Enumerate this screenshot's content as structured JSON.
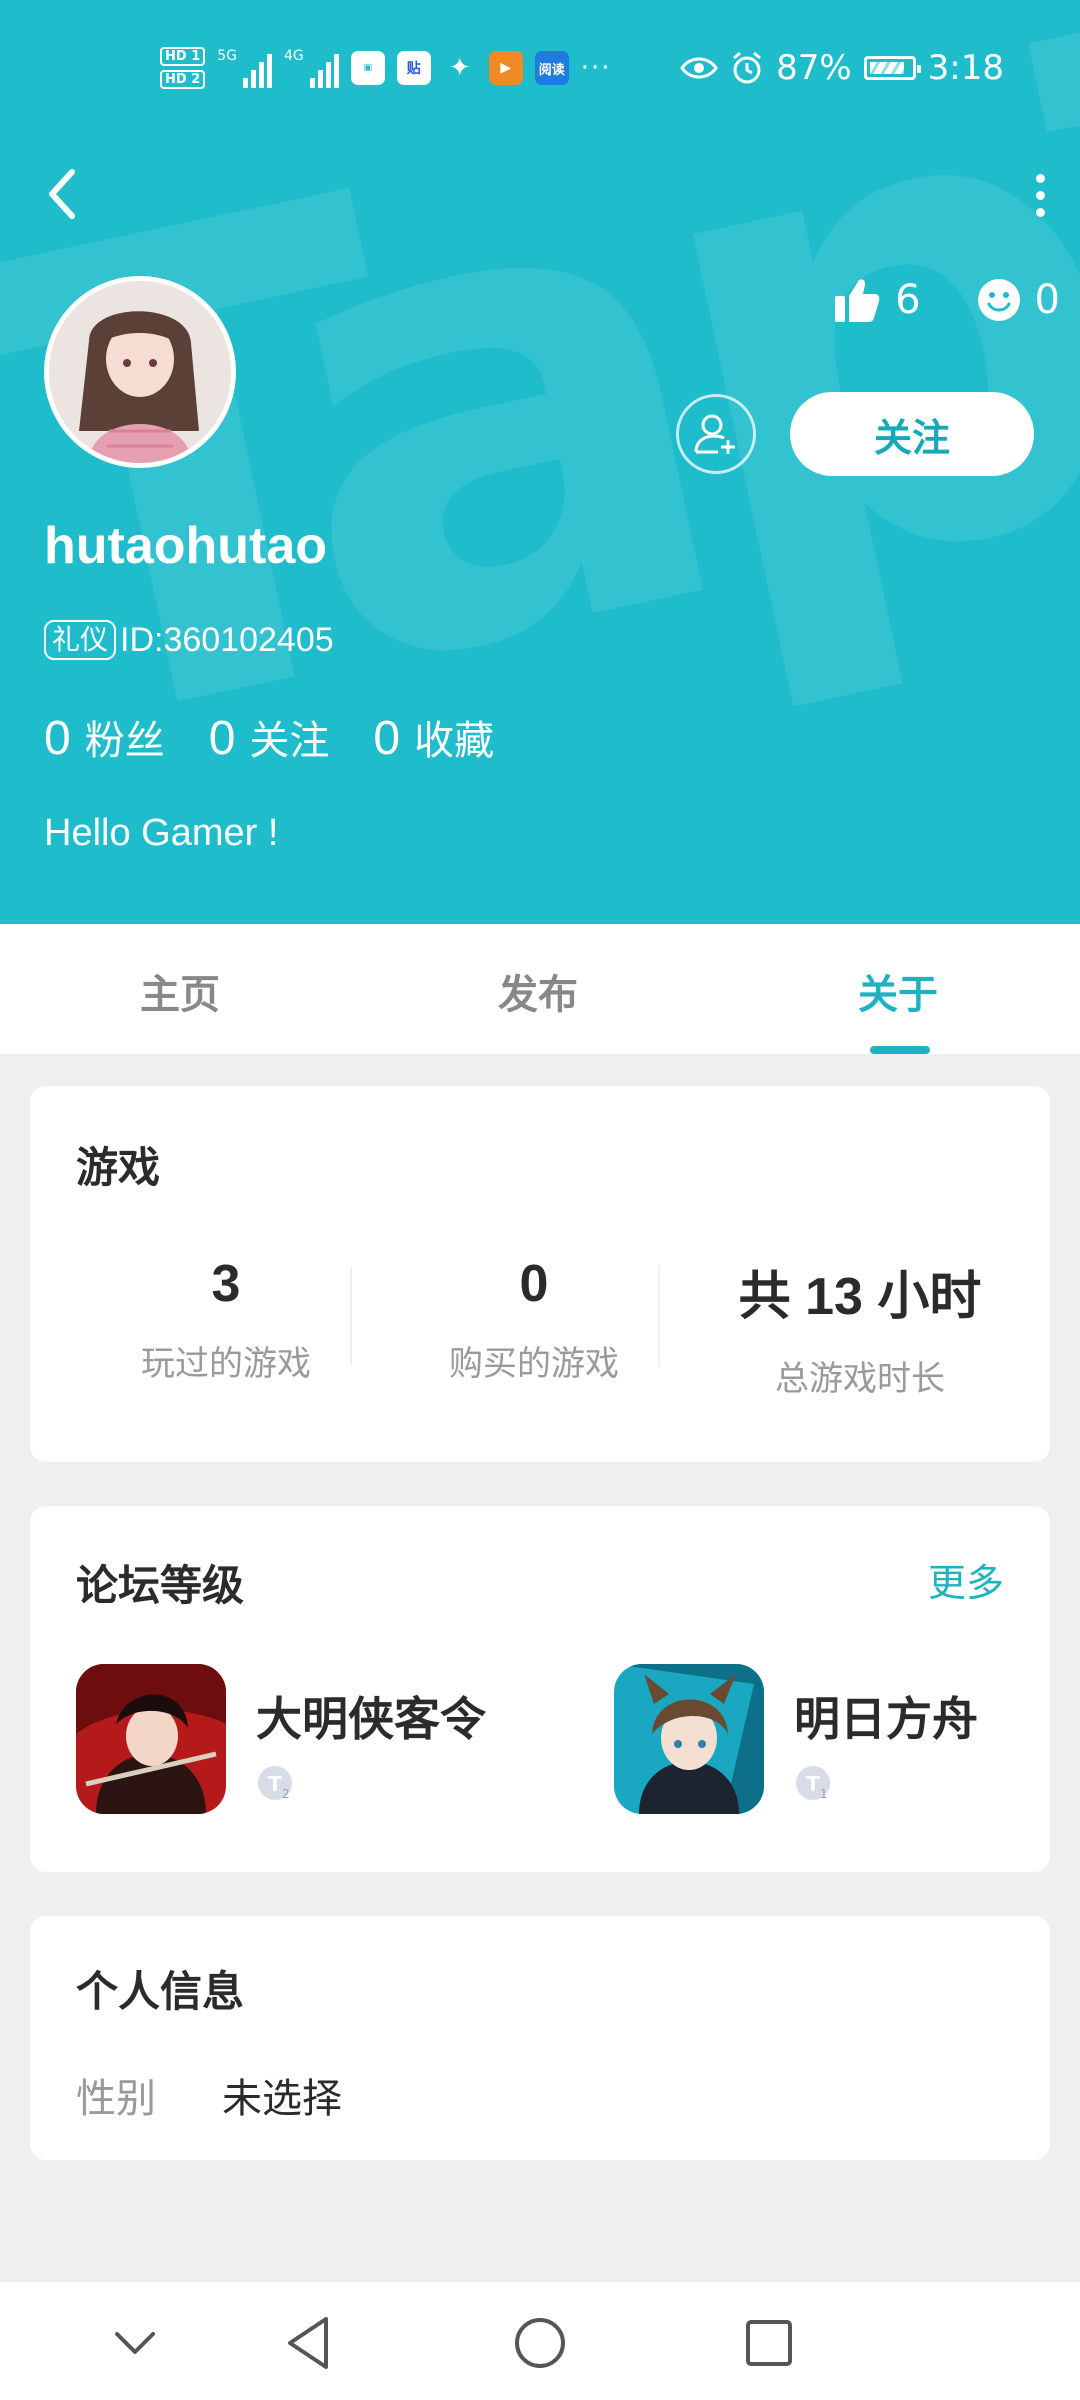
{
  "status_bar": {
    "hd1": "HD 1",
    "hd2": "HD 2",
    "net1": "5G",
    "net2": "4G",
    "app_icons": [
      "huawei-store-icon",
      "tieba-icon",
      "wechat-icon",
      "video-icon",
      "yuedu-icon"
    ],
    "app_labels": {
      "tieba": "贴",
      "yuedu": "阅读"
    },
    "more": "···",
    "battery": "87%",
    "time": "3:18"
  },
  "profile": {
    "likes": "6",
    "smiles": "0",
    "follow_label": "关注",
    "username": "hutaohutao",
    "badge": "礼仪",
    "id_text": "ID:360102405",
    "stats": [
      {
        "num": "0",
        "label": "粉丝"
      },
      {
        "num": "0",
        "label": "关注"
      },
      {
        "num": "0",
        "label": "收藏"
      }
    ],
    "bio": "Hello Gamer !"
  },
  "tabs": [
    {
      "label": "主页",
      "active": false
    },
    {
      "label": "发布",
      "active": false
    },
    {
      "label": "关于",
      "active": true
    }
  ],
  "games_card": {
    "title": "游戏",
    "stats": [
      {
        "value": "3",
        "label": "玩过的游戏"
      },
      {
        "value": "0",
        "label": "购买的游戏"
      },
      {
        "value": "共 13 小时",
        "label": "总游戏时长"
      }
    ]
  },
  "forum_card": {
    "title": "论坛等级",
    "more": "更多",
    "items": [
      {
        "name": "大明侠客令",
        "level": "2"
      },
      {
        "name": "明日方舟",
        "level": "1"
      }
    ]
  },
  "info_card": {
    "title": "个人信息",
    "gender_label": "性别",
    "gender_value": "未选择"
  },
  "colors": {
    "accent": "#1fbccb",
    "accent_dark": "#1fb2c0",
    "page_bg": "#efefef"
  }
}
